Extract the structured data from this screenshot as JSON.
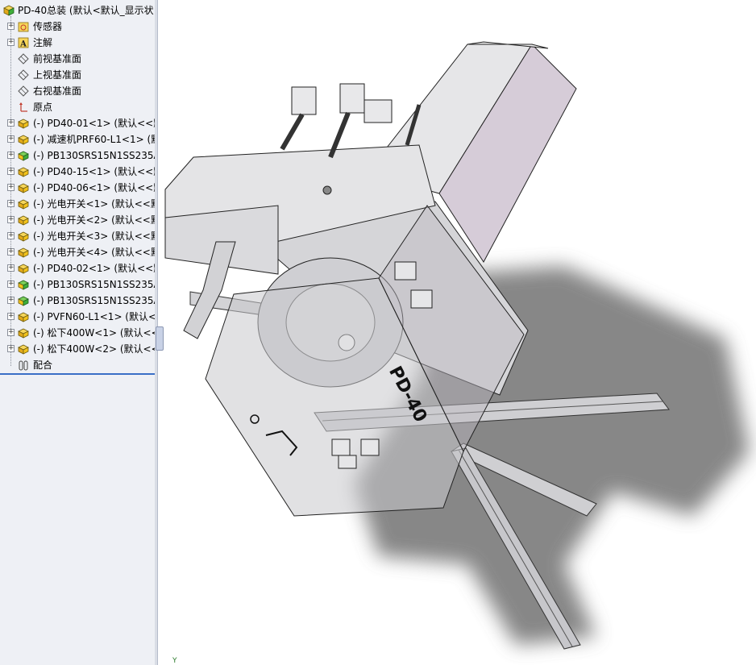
{
  "feature_tree": {
    "root_label": "PD-40总装 (默认<默认_显示状",
    "items": [
      {
        "label": "传感器",
        "icon": "sensor-folder-icon"
      },
      {
        "label": "注解",
        "icon": "annotation-icon"
      },
      {
        "label": "前视基准面",
        "icon": "plane-icon"
      },
      {
        "label": "上视基准面",
        "icon": "plane-icon"
      },
      {
        "label": "右视基准面",
        "icon": "plane-icon"
      },
      {
        "label": "原点",
        "icon": "origin-icon"
      },
      {
        "label": "(-) PD40-01<1> (默认<<默",
        "icon": "part-icon"
      },
      {
        "label": "(-) 减速机PRF60-L1<1> (默",
        "icon": "part-icon"
      },
      {
        "label": "(-) PB130SRS15N1SS235A",
        "icon": "subassembly-icon"
      },
      {
        "label": "(-) PD40-15<1> (默认<<默",
        "icon": "part-icon"
      },
      {
        "label": "(-) PD40-06<1> (默认<<默",
        "icon": "part-icon"
      },
      {
        "label": "(-) 光电开关<1> (默认<<默",
        "icon": "part-icon"
      },
      {
        "label": "(-) 光电开关<2> (默认<<默",
        "icon": "part-icon"
      },
      {
        "label": "(-) 光电开关<3> (默认<<默",
        "icon": "part-icon"
      },
      {
        "label": "(-) 光电开关<4> (默认<<默",
        "icon": "part-icon"
      },
      {
        "label": "(-) PD40-02<1> (默认<<默",
        "icon": "part-icon"
      },
      {
        "label": "(-) PB130SRS15N1SS235A",
        "icon": "subassembly-icon"
      },
      {
        "label": "(-) PB130SRS15N1SS235A",
        "icon": "subassembly-icon"
      },
      {
        "label": "(-) PVFN60-L1<1> (默认<<",
        "icon": "part-icon"
      },
      {
        "label": "(-) 松下400W<1> (默认<<",
        "icon": "part-icon"
      },
      {
        "label": "(-) 松下400W<2> (默认<<",
        "icon": "part-icon"
      },
      {
        "label": "配合",
        "icon": "mates-icon"
      }
    ]
  },
  "viewport": {
    "part_engraving": "PD-40",
    "triad_label": "Y"
  },
  "colors": {
    "panel_bg": "#eef0f5",
    "part_yellow": "#f2c21b",
    "subassembly_green": "#3fae3a",
    "model_face": "#dcdcde",
    "motor_face": "#d6ccd8",
    "shadow": "#808080"
  }
}
